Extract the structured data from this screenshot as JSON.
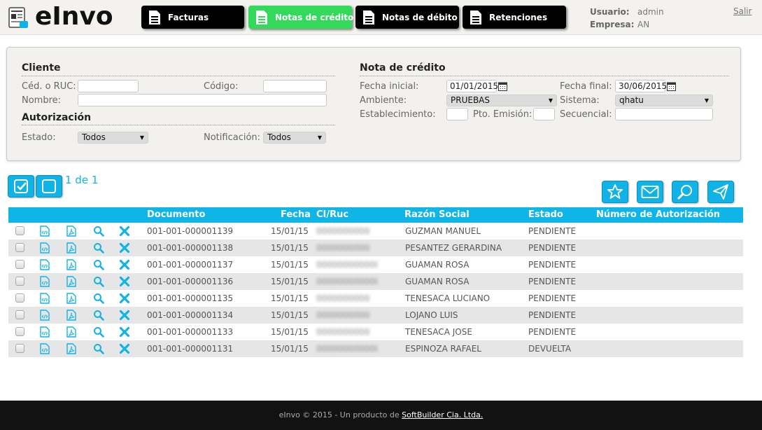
{
  "app": {
    "name": "eInvo"
  },
  "nav": [
    {
      "label": "Facturas",
      "active": false
    },
    {
      "label": "Notas de crédito",
      "active": true
    },
    {
      "label": "Notas de débito",
      "active": false
    },
    {
      "label": "Retenciones",
      "active": false
    }
  ],
  "user": {
    "user_label": "Usuario:",
    "user_value": "admin",
    "company_label": "Empresa:",
    "company_value": "AN",
    "logout": "Salir"
  },
  "filters": {
    "cliente": {
      "title": "Cliente",
      "ruc_label": "Céd. o RUC:",
      "ruc_value": "",
      "codigo_label": "Código:",
      "codigo_value": "",
      "nombre_label": "Nombre:",
      "nombre_value": ""
    },
    "autorizacion": {
      "title": "Autorización",
      "estado_label": "Estado:",
      "estado_value": "Todos",
      "notificacion_label": "Notificación:",
      "notificacion_value": "Todos"
    },
    "nota": {
      "title": "Nota de crédito",
      "fecha_inicial_label": "Fecha inicial:",
      "fecha_inicial_value": "01/01/2015",
      "fecha_final_label": "Fecha final:",
      "fecha_final_value": "30/06/2015",
      "ambiente_label": "Ambiente:",
      "ambiente_value": "PRUEBAS",
      "sistema_label": "Sistema:",
      "sistema_value": "qhatu",
      "establecimiento_label": "Establecimiento:",
      "establecimiento_value": "",
      "pto_emision_label": "Pto. Emisión:",
      "pto_emision_value": "",
      "secuencial_label": "Secuencial:",
      "secuencial_value": ""
    }
  },
  "pager": {
    "text": "1 de 1"
  },
  "colors": {
    "accent": "#0fb5e6",
    "active_nav": "#32d95a",
    "nav_bg": "#000000"
  },
  "table": {
    "headers": {
      "documento": "Documento",
      "fecha": "Fecha",
      "ciruc": "CI/Ruc",
      "razon": "Razón Social",
      "estado": "Estado",
      "autorizacion": "Número de Autorización"
    },
    "rows": [
      {
        "documento": "001-001-000001139",
        "fecha": "15/01/15",
        "ciruc": "0000000000",
        "razon": "GUZMAN MANUEL",
        "estado": "PENDIENTE",
        "autorizacion": ""
      },
      {
        "documento": "001-001-000001138",
        "fecha": "15/01/15",
        "ciruc": "0000000000",
        "razon": "PESANTEZ GERARDINA",
        "estado": "PENDIENTE",
        "autorizacion": ""
      },
      {
        "documento": "001-001-000001137",
        "fecha": "15/01/15",
        "ciruc": "0000000000001",
        "razon": "GUAMAN ROSA",
        "estado": "PENDIENTE",
        "autorizacion": ""
      },
      {
        "documento": "001-001-000001136",
        "fecha": "15/01/15",
        "ciruc": "0000000000001",
        "razon": "GUAMAN ROSA",
        "estado": "PENDIENTE",
        "autorizacion": ""
      },
      {
        "documento": "001-001-000001135",
        "fecha": "15/01/15",
        "ciruc": "0000000000",
        "razon": "TENESACA LUCIANO",
        "estado": "PENDIENTE",
        "autorizacion": ""
      },
      {
        "documento": "001-001-000001134",
        "fecha": "15/01/15",
        "ciruc": "0000000000",
        "razon": "LOJANO LUIS",
        "estado": "PENDIENTE",
        "autorizacion": ""
      },
      {
        "documento": "001-001-000001133",
        "fecha": "15/01/15",
        "ciruc": "0000000000",
        "razon": "TENESACA JOSE",
        "estado": "PENDIENTE",
        "autorizacion": ""
      },
      {
        "documento": "001-001-000001131",
        "fecha": "15/01/15",
        "ciruc": "0000000000001",
        "razon": "ESPINOZA RAFAEL",
        "estado": "DEVUELTA",
        "autorizacion": ""
      }
    ]
  },
  "footer": {
    "text": "eInvo © 2015 - Un producto de ",
    "link": "SoftBuilder Cia. Ltda."
  }
}
